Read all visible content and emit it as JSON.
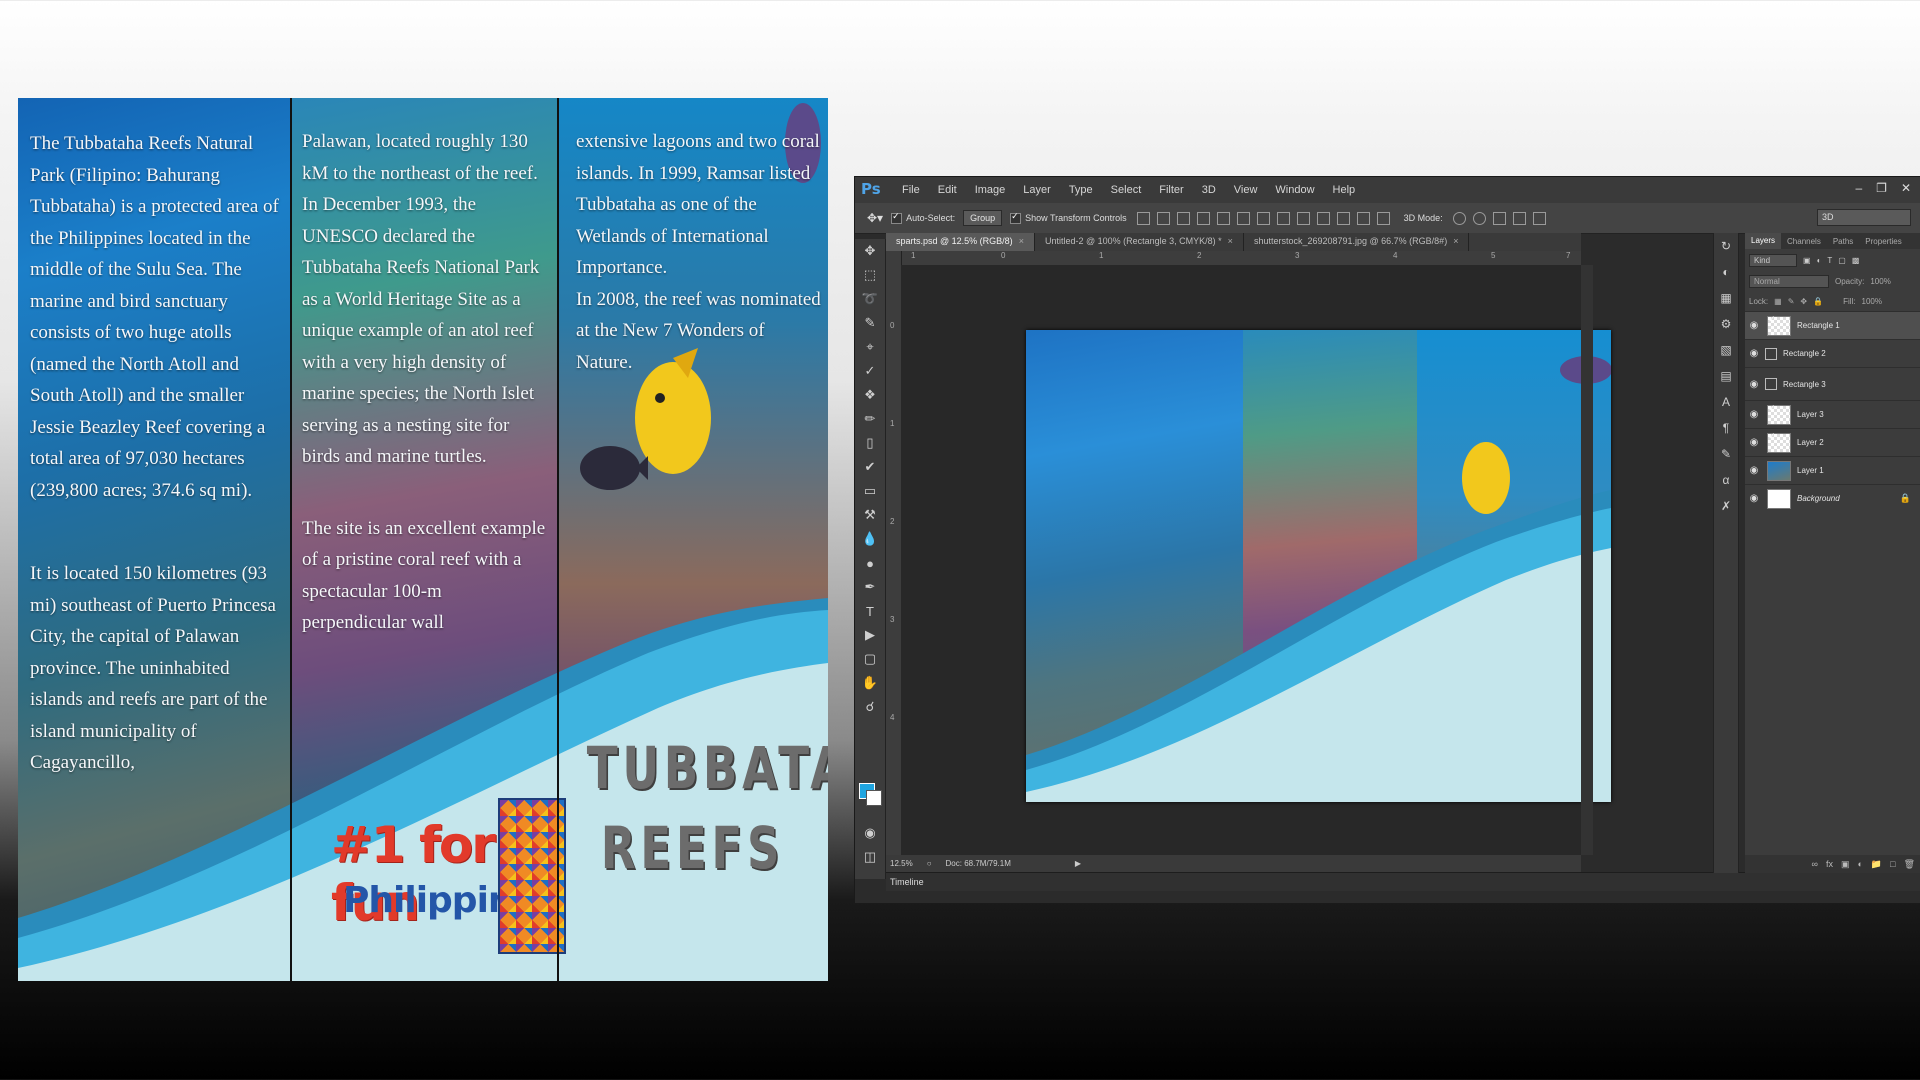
{
  "brochure": {
    "panel1": {
      "para1": "The Tubbataha Reefs Natural Park (Filipino: Bahurang Tubbataha) is a protected area of the Philippines located in the middle of the Sulu Sea. The marine and bird sanctuary consists of two huge atolls (named the North Atoll and South Atoll) and the smaller Jessie Beazley Reef covering a total area of 97,030 hectares (239,800 acres; 374.6 sq mi).",
      "para2": "It is located 150 kilometres (93 mi) southeast of Puerto Princesa City, the capital of Palawan province. The uninhabited islands and reefs are part of the island municipality of Cagayancillo,"
    },
    "panel2": {
      "para1": "Palawan, located roughly 130 kM to the northeast of the reef.",
      "para2": "In December 1993, the UNESCO declared the Tubbataha Reefs National Park as a World Heritage Site as a unique example of an atol reef with a very high density of marine species; the North Islet serving as a nesting site for birds and marine turtles.",
      "para3": "The site is an excellent example of a pristine coral reef with a spectacular 100-m perpendicular wall",
      "logo_top": "#1 for fun",
      "logo_bottom": "Philippines"
    },
    "panel3": {
      "para1": "extensive lagoons and two coral islands. In 1999, Ramsar listed Tubbataha as one of the Wetlands of International Importance.",
      "para2": "In 2008, the reef was nominated at the New 7 Wonders of Nature.",
      "title_line1": "TUBBATAHA",
      "title_line2": "REEFS"
    }
  },
  "photoshop": {
    "logo": "Ps",
    "menu": [
      "File",
      "Edit",
      "Image",
      "Layer",
      "Type",
      "Select",
      "Filter",
      "3D",
      "View",
      "Window",
      "Help"
    ],
    "options": {
      "auto_select": "Auto-Select:",
      "group": "Group",
      "show_transform": "Show Transform Controls",
      "mode_3d": "3D Mode:",
      "workspace": "3D"
    },
    "tabs": [
      "sparts.psd @ 12.5% (RGB/8)",
      "Untitled-2 @ 100% (Rectangle 3, CMYK/8) *",
      "shutterstock_269208791.jpg @ 66.7% (RGB/8#)"
    ],
    "ruler_labels": [
      "1",
      "0",
      "1",
      "2",
      "3",
      "4",
      "5",
      "6",
      "7"
    ],
    "ruler_v_labels": [
      "0",
      "1",
      "2",
      "3",
      "4"
    ],
    "status": {
      "zoom": "12.5%",
      "doc": "Doc: 68.7M/79.1M"
    },
    "timeline": "Timeline",
    "layers_panel": {
      "tabs": [
        "Layers",
        "Channels",
        "Paths",
        "Properties"
      ],
      "kind": "Kind",
      "blend": "Normal",
      "opacity_label": "Opacity:",
      "opacity_value": "100%",
      "lock_label": "Lock:",
      "fill_label": "Fill:",
      "fill_value": "100%",
      "layers": [
        "Rectangle 1",
        "Rectangle 2",
        "Rectangle 3",
        "Layer 3",
        "Layer 2",
        "Layer 1",
        "Background"
      ]
    }
  },
  "colors": {
    "wave_light": "#c5e6ec",
    "wave_mid": "#3fb4e0",
    "wave_dark": "#2a8cbc",
    "ps_accent": "#4fa4e8"
  }
}
